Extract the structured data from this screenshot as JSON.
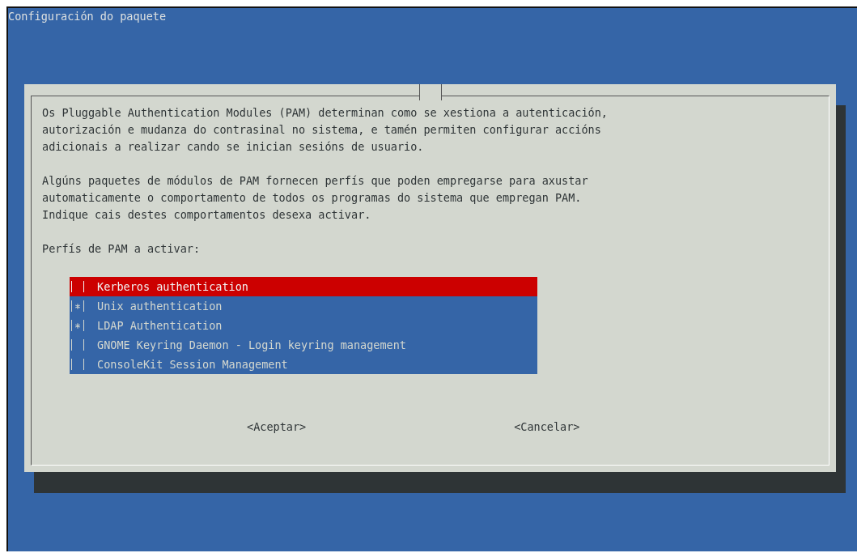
{
  "screen": {
    "title": "Configuración do paquete"
  },
  "dialog": {
    "paragraphs": [
      "Os Pluggable Authentication Modules (PAM) determinan como se xestiona a autenticación,\nautorización e mudanza do contrasinal no sistema, e tamén permiten configurar accións\nadicionais a realizar cando se inician sesións de usuario.",
      "Algúns paquetes de módulos de PAM fornecen perfís que poden empregarse para axustar\nautomaticamente o comportamento de todos os programas do sistema que empregan PAM.\nIndique cais destes comportamentos desexa activar."
    ],
    "prompt": "Perfís de PAM a activar:",
    "items": [
      {
        "label": "Kerberos authentication",
        "checked": false,
        "selected": true
      },
      {
        "label": "Unix authentication",
        "checked": true,
        "selected": false
      },
      {
        "label": "LDAP Authentication",
        "checked": true,
        "selected": false
      },
      {
        "label": "GNOME Keyring Daemon - Login keyring management",
        "checked": false,
        "selected": false
      },
      {
        "label": "ConsoleKit Session Management",
        "checked": false,
        "selected": false
      }
    ],
    "buttons": [
      "<Aceptar>",
      "<Cancelar>"
    ]
  }
}
